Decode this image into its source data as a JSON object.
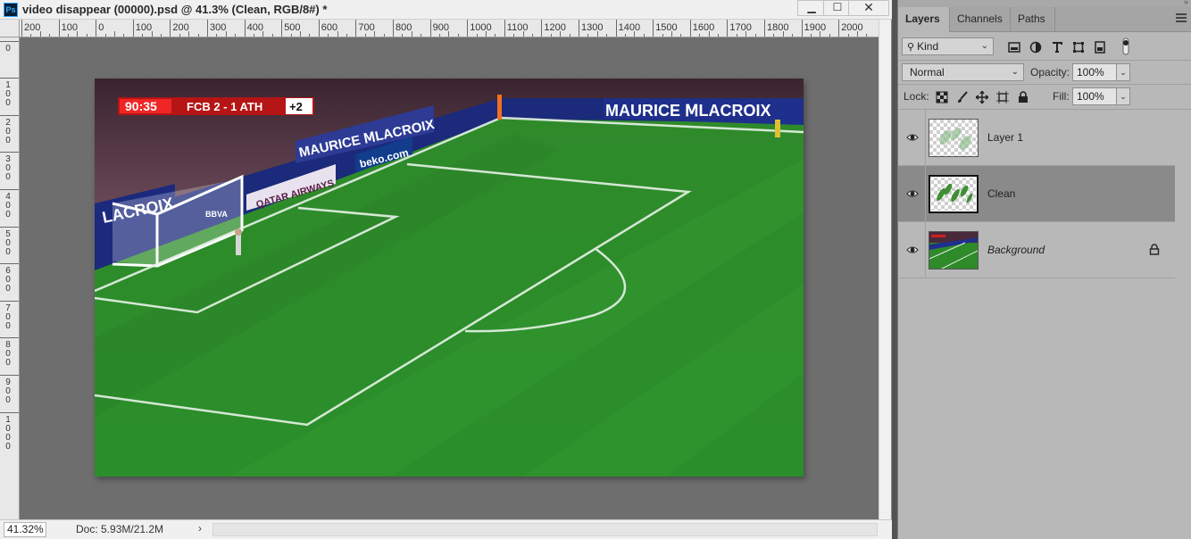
{
  "document": {
    "title": "video disappear (00000).psd @ 41.3% (Clean, RGB/8#) *",
    "app_badge": "Ps",
    "window_buttons": {
      "minimize": "▁",
      "maximize": "☐",
      "close": "✕"
    }
  },
  "ruler": {
    "horizontal_labels": [
      "200",
      "100",
      "0",
      "100",
      "200",
      "300",
      "400",
      "500",
      "600",
      "700",
      "800",
      "900",
      "1000",
      "1100",
      "1200",
      "1300",
      "1400",
      "1500",
      "1600",
      "1700",
      "1800",
      "1900",
      "2000"
    ],
    "vertical_labels": [
      "100",
      "0",
      "100",
      "200",
      "300",
      "400",
      "500",
      "600",
      "700",
      "800",
      "900",
      "1000"
    ]
  },
  "artwork": {
    "scoreboard": {
      "time": "90:35",
      "match": "FCB 2 - 1 ATH",
      "added_time": "+2"
    },
    "ads": [
      "MAURICE ⅯLACROIX",
      "MAURICE ⅯLACROIX",
      "beko.com",
      "QATAR AIRWAYS",
      "LACROIX",
      "BBVA"
    ]
  },
  "status_bar": {
    "zoom": "41.32%",
    "doc_info": "Doc: 5.93M/21.2M",
    "arrow": "›"
  },
  "panel": {
    "tabs": [
      {
        "label": "Layers",
        "active": true
      },
      {
        "label": "Channels",
        "active": false
      },
      {
        "label": "Paths",
        "active": false
      }
    ],
    "filter": {
      "kind_label": "Kind",
      "kind_icon": "search-icon"
    },
    "blend_mode": "Normal",
    "opacity_label": "Opacity:",
    "opacity_value": "100%",
    "lock_label": "Lock:",
    "fill_label": "Fill:",
    "fill_value": "100%",
    "layers": [
      {
        "name": "Layer 1",
        "visible": true,
        "selected": false,
        "locked": false,
        "italic": false
      },
      {
        "name": "Clean",
        "visible": true,
        "selected": true,
        "locked": false,
        "italic": false
      },
      {
        "name": "Background",
        "visible": true,
        "selected": false,
        "locked": true,
        "italic": true
      }
    ]
  }
}
